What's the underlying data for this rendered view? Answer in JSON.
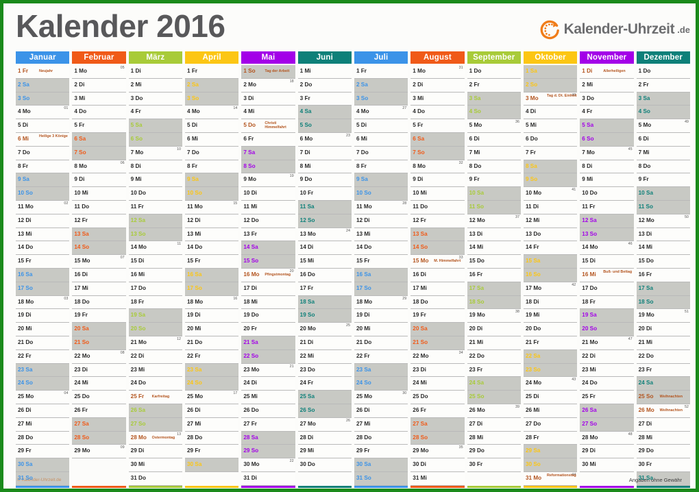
{
  "title": "Kalender 2016",
  "logo": {
    "name": "Kalender-Uhrzeit",
    "tld": ".de",
    "mark_icon": "clock-arrow-icon",
    "color": "#f07d1a"
  },
  "footer": {
    "left": "© Kalender-Uhrzeit.de",
    "right": "Angaben ohne Gewähr"
  },
  "day_names": {
    "mo": "Mo",
    "di": "Di",
    "mi": "Mi",
    "do": "Do",
    "fr": "Fr",
    "sa": "Sa",
    "so": "So"
  },
  "holiday_color": "#b3541e",
  "weekend_bg": "#c8c9c4",
  "months": [
    {
      "name": "Januar",
      "color": "#3b93e8",
      "first_dow": 5,
      "days": 31,
      "weeknums": {
        "4": "01",
        "11": "02",
        "18": "03",
        "25": "04"
      },
      "holidays": {
        "1": "Neujahr",
        "6": "Heilige 3 Könige"
      }
    },
    {
      "name": "Februar",
      "color": "#f05a18",
      "first_dow": 1,
      "days": 29,
      "weeknums": {
        "1": "05",
        "8": "06",
        "15": "07",
        "22": "08",
        "29": "09"
      },
      "holidays": {}
    },
    {
      "name": "März",
      "color": "#a8cb38",
      "first_dow": 2,
      "days": 31,
      "weeknums": {
        "7": "10",
        "14": "11",
        "21": "12",
        "28": "13"
      },
      "holidays": {
        "25": "Karfreitag",
        "28": "Ostermontag"
      }
    },
    {
      "name": "April",
      "color": "#fcc614",
      "first_dow": 5,
      "days": 30,
      "weeknums": {
        "4": "14",
        "11": "15",
        "18": "16",
        "25": "17"
      },
      "holidays": {}
    },
    {
      "name": "Mai",
      "color": "#a300e8",
      "first_dow": 7,
      "days": 31,
      "weeknums": {
        "2": "18",
        "9": "19",
        "16": "20",
        "23": "21",
        "30": "22"
      },
      "holidays": {
        "1": "Tag der Arbeit",
        "5": "Christi Himmelfahrt",
        "16": "Pfingstmontag"
      }
    },
    {
      "name": "Juni",
      "color": "#0e8079",
      "first_dow": 3,
      "days": 30,
      "weeknums": {
        "6": "23",
        "13": "24",
        "20": "25",
        "27": "26"
      },
      "holidays": {}
    },
    {
      "name": "Juli",
      "color": "#3b93e8",
      "first_dow": 5,
      "days": 31,
      "weeknums": {
        "4": "27",
        "11": "28",
        "18": "29",
        "25": "30"
      },
      "holidays": {}
    },
    {
      "name": "August",
      "color": "#f05a18",
      "first_dow": 1,
      "days": 31,
      "weeknums": {
        "1": "31",
        "8": "32",
        "15": "33",
        "22": "34",
        "29": "35"
      },
      "holidays": {
        "15": "M. Himmelfahrt"
      }
    },
    {
      "name": "September",
      "color": "#a8cb38",
      "first_dow": 4,
      "days": 30,
      "weeknums": {
        "5": "36",
        "12": "37",
        "19": "38",
        "26": "39"
      },
      "holidays": {}
    },
    {
      "name": "Oktober",
      "color": "#fcc614",
      "first_dow": 6,
      "days": 31,
      "weeknums": {
        "3": "40",
        "10": "41",
        "17": "42",
        "24": "43",
        "31": "44"
      },
      "holidays": {
        "3": "Tag d. Dt. Einheit",
        "31": "Reformationstag"
      }
    },
    {
      "name": "November",
      "color": "#a300e8",
      "first_dow": 2,
      "days": 30,
      "weeknums": {
        "7": "45",
        "14": "46",
        "21": "47",
        "28": "48"
      },
      "holidays": {
        "1": "Allerheiligen",
        "16": "Buß- und Bettag"
      }
    },
    {
      "name": "Dezember",
      "color": "#0e8079",
      "first_dow": 4,
      "days": 31,
      "weeknums": {
        "5": "49",
        "12": "50",
        "19": "51",
        "26": "52"
      },
      "holidays": {
        "25": "Weihnachten",
        "26": "Weihnachten"
      }
    }
  ]
}
